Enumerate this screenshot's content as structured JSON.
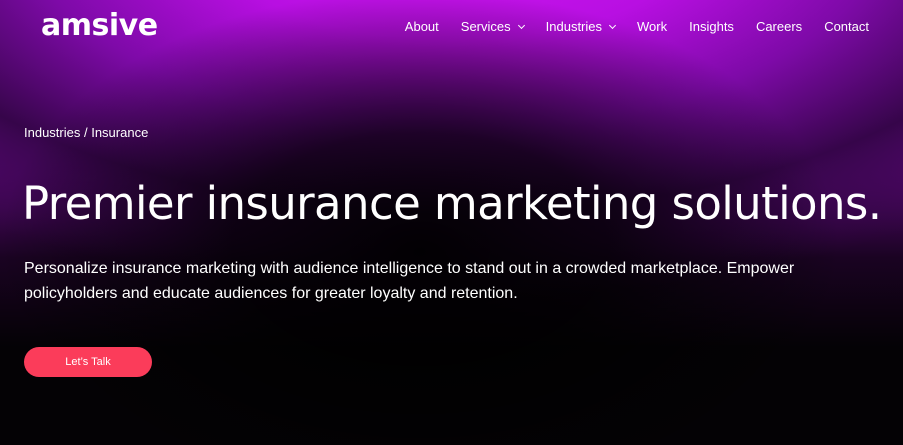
{
  "brand": {
    "logo_text": "amsive"
  },
  "nav": {
    "items": [
      {
        "label": "About"
      },
      {
        "label": "Services"
      },
      {
        "label": "Industries"
      },
      {
        "label": "Work"
      },
      {
        "label": "Insights"
      },
      {
        "label": "Careers"
      },
      {
        "label": "Contact"
      }
    ]
  },
  "breadcrumb": {
    "parent": "Industries",
    "separator": "/",
    "current": "Insurance"
  },
  "hero": {
    "title": "Premier insurance marketing solutions.",
    "subtitle": "Personalize insurance marketing with audience intelligence to stand out in a crowded marketplace. Empower policyholders and educate audiences for greater loyalty and retention.",
    "cta_label": "Let’s Talk"
  },
  "colors": {
    "accent_magenta": "#d517f6",
    "cta_red": "#fb3c5a",
    "background_dark": "#050307"
  }
}
